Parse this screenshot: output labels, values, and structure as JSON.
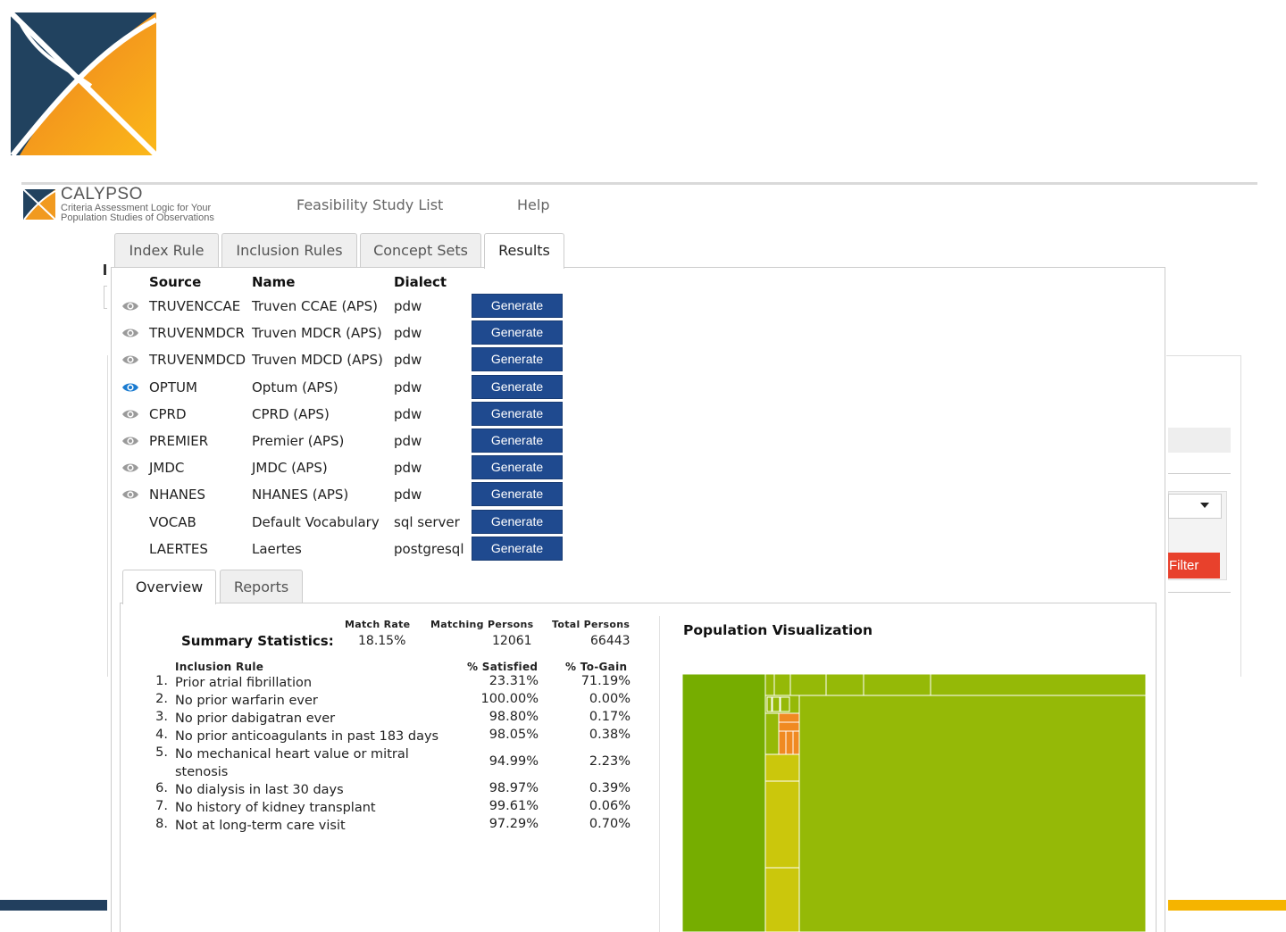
{
  "header": {
    "brand_name": "CALYPSO",
    "brand_sub_line1": "Criteria Assessment Logic for Your",
    "brand_sub_line2": "Population Studies of Observations",
    "nav": [
      "Feasibility Study List",
      "Help"
    ]
  },
  "tabs": [
    "Index Rule",
    "Inclusion Rules",
    "Concept Sets",
    "Results"
  ],
  "active_tab": "Results",
  "sources": {
    "headers": {
      "source": "Source",
      "name": "Name",
      "dialect": "Dialect"
    },
    "button_label": "Generate",
    "rows": [
      {
        "source": "TRUVENCCAE",
        "name": "Truven CCAE (APS)",
        "dialect": "pdw",
        "icon": "eye-icon",
        "selected": false
      },
      {
        "source": "TRUVENMDCR",
        "name": "Truven MDCR (APS)",
        "dialect": "pdw",
        "icon": "eye-icon",
        "selected": false
      },
      {
        "source": "TRUVENMDCD",
        "name": "Truven MDCD (APS)",
        "dialect": "pdw",
        "icon": "eye-icon",
        "selected": false
      },
      {
        "source": "OPTUM",
        "name": "Optum (APS)",
        "dialect": "pdw",
        "icon": "eye-icon",
        "selected": true
      },
      {
        "source": "CPRD",
        "name": "CPRD (APS)",
        "dialect": "pdw",
        "icon": "eye-icon",
        "selected": false
      },
      {
        "source": "PREMIER",
        "name": "Premier (APS)",
        "dialect": "pdw",
        "icon": "eye-icon",
        "selected": false
      },
      {
        "source": "JMDC",
        "name": "JMDC (APS)",
        "dialect": "pdw",
        "icon": "eye-icon",
        "selected": false
      },
      {
        "source": "NHANES",
        "name": "NHANES (APS)",
        "dialect": "pdw",
        "icon": "eye-icon",
        "selected": false
      },
      {
        "source": "VOCAB",
        "name": "Default Vocabulary",
        "dialect": "sql server",
        "icon": "",
        "selected": false
      },
      {
        "source": "LAERTES",
        "name": "Laertes",
        "dialect": "postgresql",
        "icon": "",
        "selected": false
      }
    ]
  },
  "subtabs": [
    "Overview",
    "Reports"
  ],
  "active_subtab": "Overview",
  "summary": {
    "label": "Summary Statistics:",
    "match_rate_label": "Match Rate",
    "match_rate": "18.15%",
    "matching_label": "Matching Persons",
    "matching": "12061",
    "total_label": "Total Persons",
    "total": "66443"
  },
  "rules": {
    "headers": {
      "rule": "Inclusion Rule",
      "satisfied": "% Satisfied",
      "gain": "% To-Gain"
    },
    "rows": [
      {
        "num": "1.",
        "text": "Prior atrial fibrillation",
        "satisfied": "23.31%",
        "gain": "71.19%"
      },
      {
        "num": "2.",
        "text": "No prior warfarin ever",
        "satisfied": "100.00%",
        "gain": "0.00%"
      },
      {
        "num": "3.",
        "text": "No prior dabigatran ever",
        "satisfied": "98.80%",
        "gain": "0.17%"
      },
      {
        "num": "4.",
        "text": "No prior anticoagulants in past 183 days",
        "satisfied": "98.05%",
        "gain": "0.38%"
      },
      {
        "num": "5.",
        "text": "No mechanical heart value or mitral stenosis",
        "satisfied": "94.99%",
        "gain": "2.23%"
      },
      {
        "num": "6.",
        "text": "No dialysis in last 30 days",
        "satisfied": "98.97%",
        "gain": "0.39%"
      },
      {
        "num": "7.",
        "text": "No history of kidney transplant",
        "satisfied": "99.61%",
        "gain": "0.06%"
      },
      {
        "num": "8.",
        "text": "Not at long-term care visit",
        "satisfied": "97.29%",
        "gain": "0.70%"
      }
    ]
  },
  "visualization": {
    "title": "Population Visualization",
    "colors": {
      "dark_green": "#76ad00",
      "mid_green": "#95b907",
      "yellow_green": "#cbc70c",
      "orange": "#f08a22"
    }
  },
  "background": {
    "filter_label": "Filter"
  },
  "colors": {
    "generate_button": "#1f4a8f",
    "selected_eye": "#1a7bd0",
    "filter_button": "#e8412c",
    "footer_left": "#223f5e",
    "footer_right": "#f5b400"
  }
}
